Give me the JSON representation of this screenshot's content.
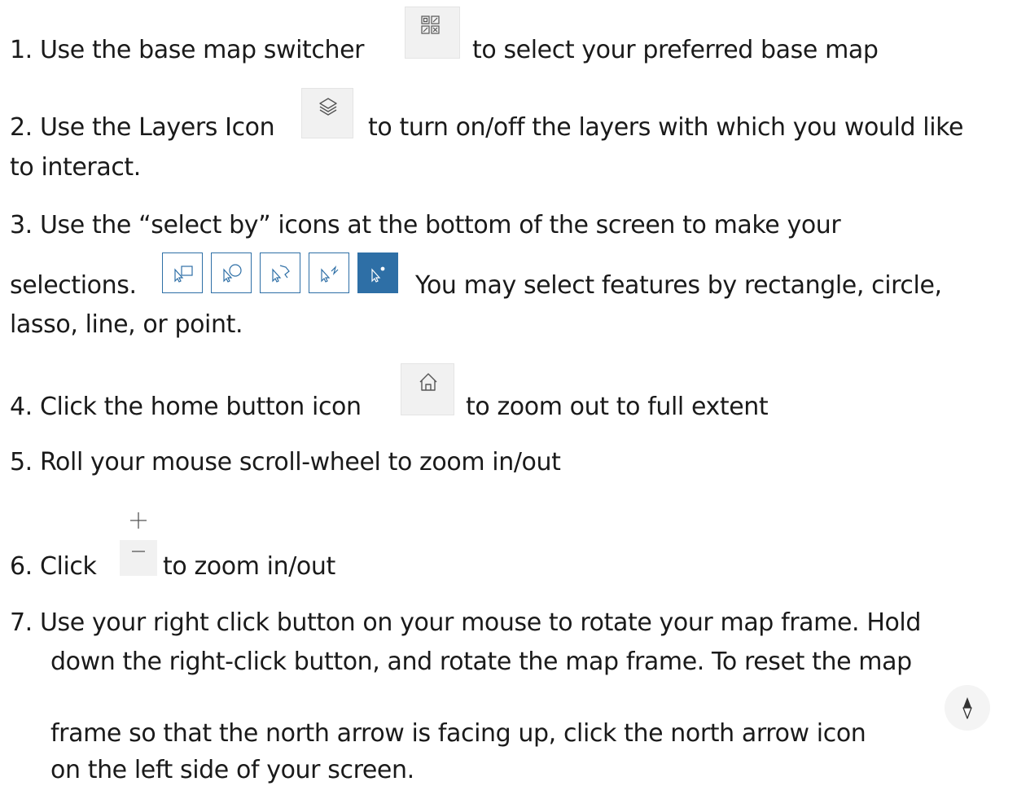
{
  "instructions": {
    "step1": {
      "before": "1. Use the base map switcher",
      "after": "to select your preferred base map",
      "icon": "basemap-gallery-icon"
    },
    "step2": {
      "before": "2. Use the Layers Icon",
      "after": "to turn on/off the layers with which you would like",
      "continuation": "to interact.",
      "icon": "layers-icon"
    },
    "step3": {
      "line1": "3. Use the “select by” icons at the bottom of the screen to make your",
      "before": "selections.",
      "after": "You may select features by rectangle, circle,",
      "continuation": "lasso, line, or point.",
      "icons": [
        "select-rectangle-icon",
        "select-circle-icon",
        "select-lasso-icon",
        "select-line-icon",
        "select-point-icon"
      ]
    },
    "step4": {
      "before": "4. Click the home button icon",
      "after": "to zoom out to full extent",
      "icon": "home-icon"
    },
    "step5": {
      "text": "5. Roll your mouse scroll-wheel to zoom in/out"
    },
    "step6": {
      "before": "6. Click",
      "after": "to zoom in/out",
      "icons": [
        "zoom-in-icon",
        "zoom-out-icon"
      ]
    },
    "step7": {
      "line1": "7. Use your right click button on your mouse to rotate your map frame. Hold",
      "line2": "down the right-click button, and rotate the map frame. To reset the map",
      "line3": "frame so that the north arrow is facing up, click the north arrow icon",
      "line4": "on the left side of your screen.",
      "icon": "north-arrow-icon"
    }
  },
  "colors": {
    "text": "#1a1a1a",
    "icon_bg": "#f1f1f1",
    "accent": "#2e6fa6"
  }
}
